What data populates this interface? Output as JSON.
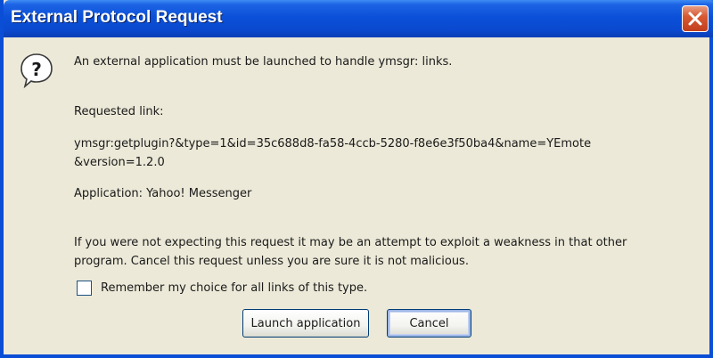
{
  "window": {
    "title": "External Protocol Request"
  },
  "titlebar": {
    "close_icon": "close-icon",
    "accent_color": "#0A4ED6",
    "close_color": "#D85A33"
  },
  "dialog": {
    "icon": "question-icon",
    "message": "An external application must be launched to handle ymsgr: links.",
    "requested_link_label": "Requested link:",
    "link_line1": "ymsgr:getplugin?&type=1&id=35c688d8-fa58-4ccb-5280-f8e6e3f50ba4&name=YEmote",
    "link_line2": "&version=1.2.0",
    "application": "Application: Yahoo! Messenger",
    "warning_line1": "If you were not expecting this request it may be an attempt to exploit a weakness in that other",
    "warning_line2": "program. Cancel this request unless you are sure it is not malicious.",
    "remember_label": "Remember my choice for all links of this type.",
    "remember_checked": false
  },
  "buttons": {
    "launch_label": "Launch application",
    "cancel_label": "Cancel"
  }
}
